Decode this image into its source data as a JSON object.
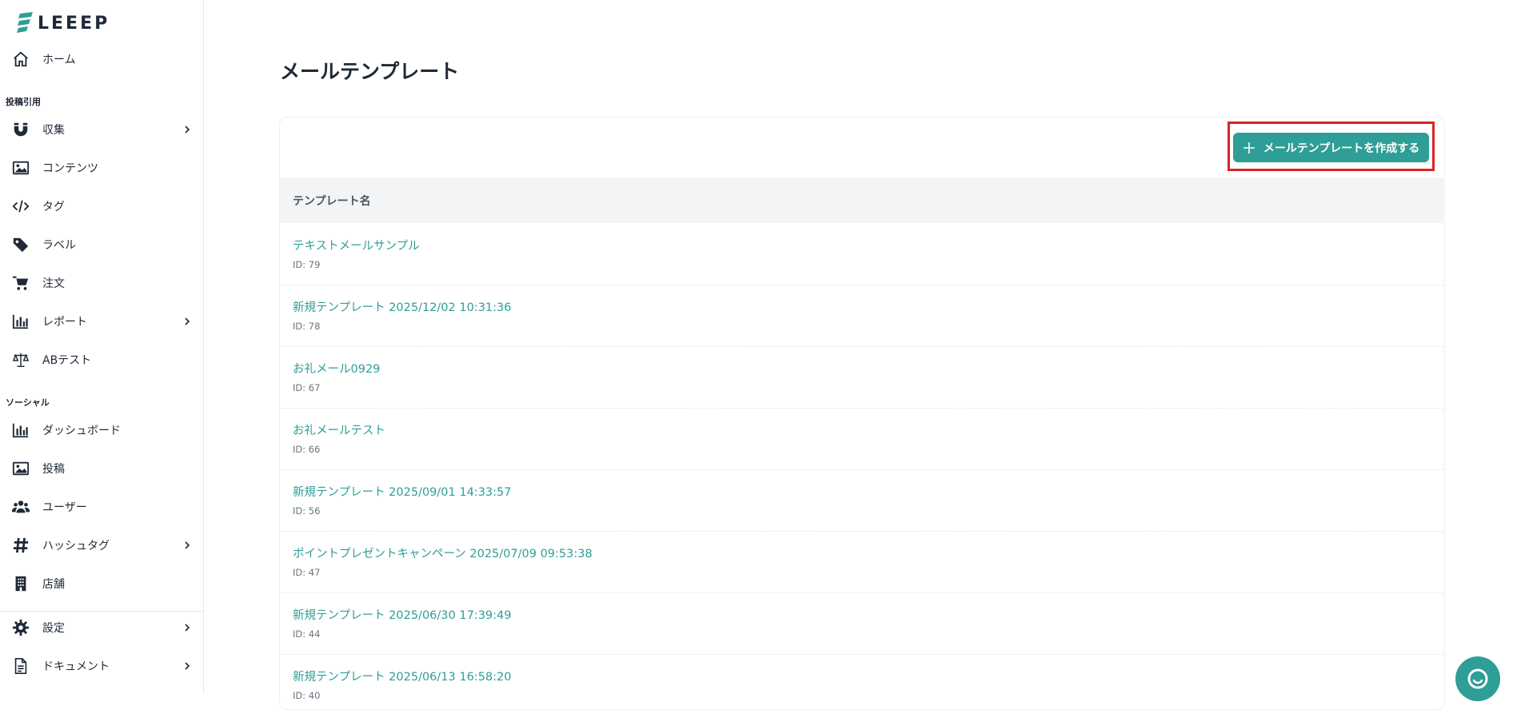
{
  "brand": {
    "name": "LEEEP",
    "accent": "#2e9e96",
    "highlight": "#d9232a"
  },
  "sidebar": {
    "home": {
      "label": "ホーム",
      "icon": "home-icon"
    },
    "section_posts": "投稿引用",
    "posts_items": [
      {
        "label": "収集",
        "icon": "magnet-icon",
        "has_submenu": true
      },
      {
        "label": "コンテンツ",
        "icon": "image-icon",
        "has_submenu": false
      },
      {
        "label": "タグ",
        "icon": "code-icon",
        "has_submenu": false
      },
      {
        "label": "ラベル",
        "icon": "tag-icon",
        "has_submenu": false
      },
      {
        "label": "注文",
        "icon": "cart-icon",
        "has_submenu": false
      },
      {
        "label": "レポート",
        "icon": "bar-chart-icon",
        "has_submenu": true
      },
      {
        "label": "ABテスト",
        "icon": "scale-icon",
        "has_submenu": false
      }
    ],
    "section_social": "ソーシャル",
    "social_items": [
      {
        "label": "ダッシュボード",
        "icon": "bar-chart-icon",
        "has_submenu": false
      },
      {
        "label": "投稿",
        "icon": "image-icon",
        "has_submenu": false
      },
      {
        "label": "ユーザー",
        "icon": "users-icon",
        "has_submenu": false
      },
      {
        "label": "ハッシュタグ",
        "icon": "hashtag-icon",
        "has_submenu": true
      },
      {
        "label": "店舗",
        "icon": "building-icon",
        "has_submenu": false
      }
    ],
    "bottom_items": [
      {
        "label": "設定",
        "icon": "gear-icon",
        "has_submenu": true
      },
      {
        "label": "ドキュメント",
        "icon": "document-icon",
        "has_submenu": true
      }
    ]
  },
  "main": {
    "title": "メールテンプレート",
    "create_button": "メールテンプレートを作成する",
    "table": {
      "column_header": "テンプレート名",
      "rows": [
        {
          "name": "テキストメールサンプル",
          "id": "ID: 79"
        },
        {
          "name": "新規テンプレート 2025/12/02 10:31:36",
          "id": "ID: 78"
        },
        {
          "name": "お礼メール0929",
          "id": "ID: 67"
        },
        {
          "name": "お礼メールテスト",
          "id": "ID: 66"
        },
        {
          "name": "新規テンプレート 2025/09/01 14:33:57",
          "id": "ID: 56"
        },
        {
          "name": "ポイントプレゼントキャンペーン 2025/07/09 09:53:38",
          "id": "ID: 47"
        },
        {
          "name": "新規テンプレート 2025/06/30 17:39:49",
          "id": "ID: 44"
        },
        {
          "name": "新規テンプレート 2025/06/13 16:58:20",
          "id": "ID: 40"
        }
      ]
    }
  }
}
